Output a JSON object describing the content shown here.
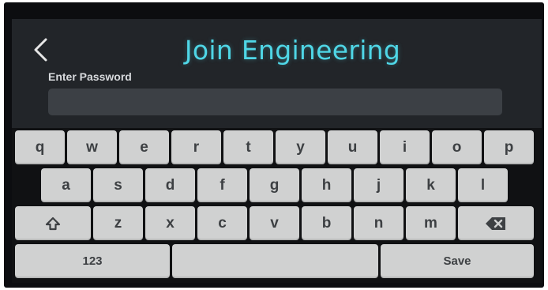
{
  "header": {
    "title": "Join Engineering",
    "back_icon": "chevron-left-icon"
  },
  "password": {
    "label": "Enter Password",
    "value": "",
    "placeholder": ""
  },
  "keyboard": {
    "row1": [
      "q",
      "w",
      "e",
      "r",
      "t",
      "y",
      "u",
      "i",
      "o",
      "p"
    ],
    "row2": [
      "a",
      "s",
      "d",
      "f",
      "g",
      "h",
      "j",
      "k",
      "l"
    ],
    "row3": [
      "z",
      "x",
      "c",
      "v",
      "b",
      "n",
      "m"
    ],
    "shift_icon": "shift-icon",
    "backspace_icon": "backspace-icon",
    "numbers_label": "123",
    "space_label": "",
    "save_label": "Save"
  },
  "colors": {
    "title": "#4fd6e6",
    "screen_bg": "#222529",
    "field_bg": "#3c4045",
    "key_bg": "#d0d1d1",
    "key_text": "#3d4043"
  }
}
